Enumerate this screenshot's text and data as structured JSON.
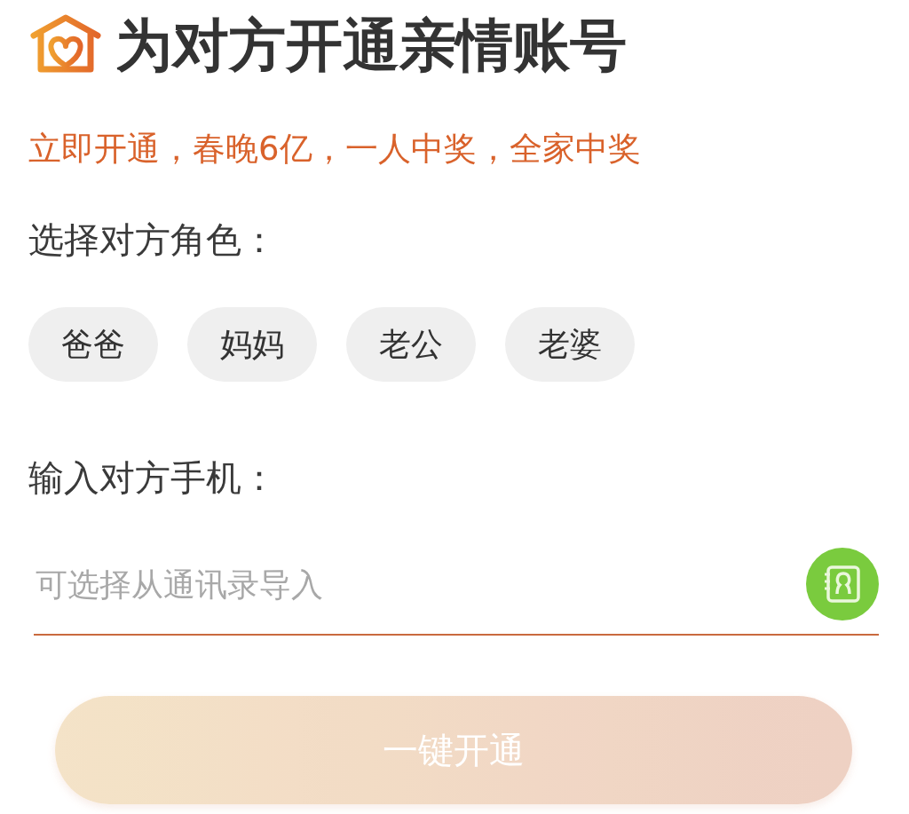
{
  "header": {
    "title": "为对方开通亲情账号"
  },
  "promo": "立即开通，春晚6亿，一人中奖，全家中奖",
  "role_label": "选择对方角色：",
  "roles": [
    {
      "label": "爸爸",
      "selected": false
    },
    {
      "label": "妈妈",
      "selected": false
    },
    {
      "label": "老公",
      "selected": false
    },
    {
      "label": "老婆",
      "selected": false
    }
  ],
  "phone_label": "输入对方手机：",
  "phone_field": {
    "placeholder": "可选择从通讯录导入"
  },
  "submit": {
    "label": "一键开通",
    "disabled": true
  }
}
